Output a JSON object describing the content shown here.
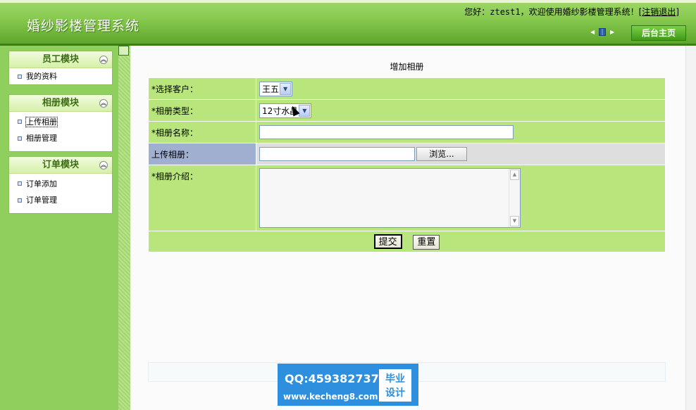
{
  "header": {
    "app_title": "婚纱影楼管理系统",
    "welcome_prefix": "您好：",
    "username": "ztest1",
    "welcome_suffix": "，欢迎使用婚纱影楼管理系统！[",
    "logout_label": "注销退出",
    "welcome_end": "]",
    "home_button": "后台主页"
  },
  "sidebar": {
    "panels": [
      {
        "title": "员工模块",
        "items": [
          "我的资料"
        ]
      },
      {
        "title": "相册模块",
        "items": [
          "上传相册",
          "相册管理"
        ]
      },
      {
        "title": "订单模块",
        "items": [
          "订单添加",
          "订单管理"
        ]
      }
    ]
  },
  "form": {
    "title": "增加相册",
    "customer_label": "*选择客户：",
    "customer_value": "王五",
    "type_label": "*相册类型：",
    "type_value": "12寸水晶",
    "name_label": "*相册名称：",
    "name_value": "",
    "upload_label": "上传相册：",
    "browse_label": "浏览...",
    "intro_label": "*相册介绍：",
    "submit_label": "提交",
    "reset_label": "重置"
  },
  "watermark": {
    "qq": "QQ:459382737",
    "site": "www.kecheng8.com",
    "badge_line1": "毕业",
    "badge_line2": "设计"
  },
  "colors": {
    "header_green": "#86c84e",
    "sidebar_green": "#8fcf5d",
    "form_row_green": "#b8e67c",
    "upload_label_blue": "#a0aed0"
  }
}
